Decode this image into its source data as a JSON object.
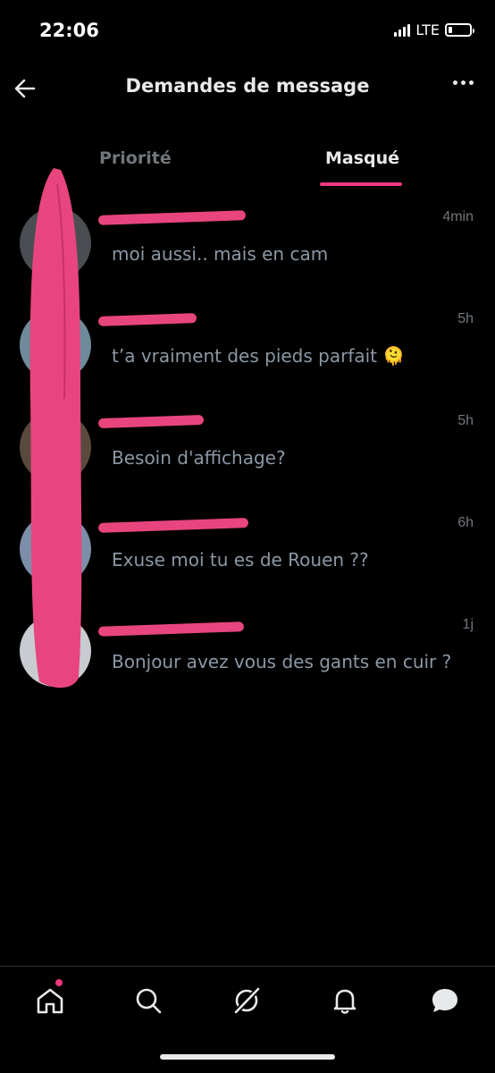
{
  "status_bar": {
    "time": "22:06",
    "network": "LTE",
    "battery_level": 0.2
  },
  "header": {
    "title": "Demandes de message"
  },
  "tabs": [
    {
      "label": "Priorité",
      "active": false
    },
    {
      "label": "Masqué",
      "active": true
    }
  ],
  "accent_color": "#f0387f",
  "conversations": [
    {
      "time": "4min",
      "message": "moi aussi.. mais en cam"
    },
    {
      "time": "5h",
      "message": "t’a vraiment des pieds parfait 🫠"
    },
    {
      "time": "5h",
      "message": "Besoin d'affichage?"
    },
    {
      "time": "6h",
      "message": "Exuse moi tu es de Rouen ??"
    },
    {
      "time": "1j",
      "message": "Bonjour avez vous des gants en cuir ?"
    }
  ],
  "bottom_nav": [
    {
      "icon": "home-icon",
      "has_notification_dot": true
    },
    {
      "icon": "search-icon"
    },
    {
      "icon": "grok-icon"
    },
    {
      "icon": "bell-icon"
    },
    {
      "icon": "messages-icon",
      "active": true
    }
  ]
}
